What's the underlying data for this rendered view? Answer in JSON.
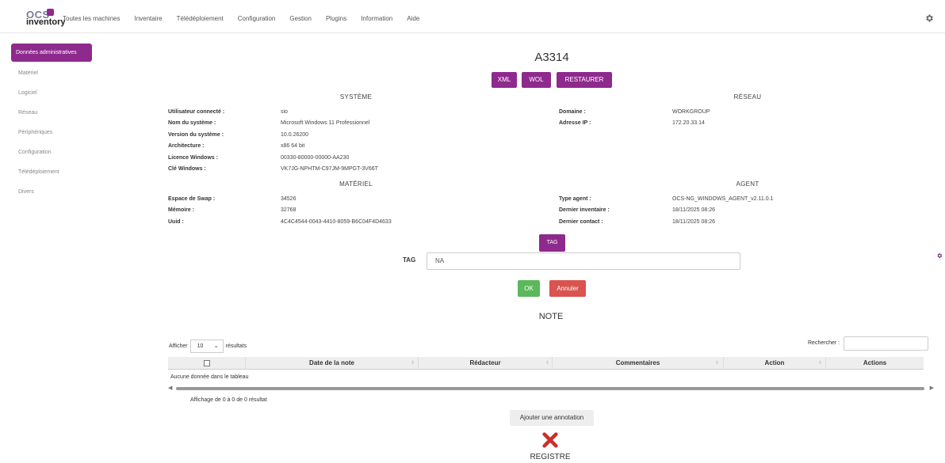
{
  "brand": {
    "logo_top": "OCS",
    "logo_bottom": "inventory"
  },
  "nav": [
    "Toutes les machines",
    "Inventaire",
    "Télédéploiement",
    "Configuration",
    "Gestion",
    "Plugins",
    "Information",
    "Aide"
  ],
  "sidebar": {
    "active": "Données administratives",
    "items": [
      "Matériel",
      "Logiciel",
      "Réseau",
      "Périphériques",
      "Configuration",
      "Télédéploiement",
      "Divers"
    ]
  },
  "machine_title": "A3314",
  "actions": {
    "xml": "XML",
    "wol": "WOL",
    "restaurer": "RESTAURER"
  },
  "systeme": {
    "title": "SYSTÈME",
    "rows": [
      {
        "label": "Utilisateur connecté :",
        "value": "sio"
      },
      {
        "label": "Nom du système :",
        "value": "Microsoft Windows 11 Professionnel"
      },
      {
        "label": "Version du système :",
        "value": "10.0.26200"
      },
      {
        "label": "Architecture :",
        "value": "x86 64 bit"
      },
      {
        "label": "Licence Windows :",
        "value": "00330-80000-00000-AA230"
      },
      {
        "label": "Clé Windows :",
        "value": "VK7JG-NPHTM-C97JM-9MPGT-3V66T"
      }
    ]
  },
  "reseau": {
    "title": "RÉSEAU",
    "rows": [
      {
        "label": "Domaine :",
        "value": "WORKGROUP"
      },
      {
        "label": "Adresse IP :",
        "value": "172.20.33.14"
      }
    ]
  },
  "materiel": {
    "title": "MATÉRIEL",
    "rows": [
      {
        "label": "Espace de Swap :",
        "value": "34526"
      },
      {
        "label": "Mémoire :",
        "value": "32768"
      },
      {
        "label": "Uuid :",
        "value": "4C4C4544-0043-4410-8059-B6C04F4D4633"
      }
    ]
  },
  "agent": {
    "title": "AGENT",
    "rows": [
      {
        "label": "Type agent :",
        "value": "OCS-NG_WINDOWS_AGENT_v2.11.0.1"
      },
      {
        "label": "Dernier inventaire :",
        "value": "18/11/2025 08:26"
      },
      {
        "label": "Dernier contact :",
        "value": "18/11/2025 08:26"
      }
    ]
  },
  "tag": {
    "button": "TAG",
    "label": "TAG",
    "value": "NA",
    "ok": "OK",
    "cancel": "Annuler"
  },
  "note": {
    "title": "NOTE",
    "show_prefix": "Afficher",
    "page_size": "10",
    "show_suffix": "résultats",
    "search_label": "Rechercher :",
    "columns": [
      "Date de la note",
      "Rédacteur",
      "Commentaires",
      "Action",
      "Actions"
    ],
    "empty": "Aucune donnée dans le tableau",
    "info": "Affichage de 0 à 0 de 0 résultat",
    "add_button": "Ajouter une annotation"
  },
  "registre": {
    "title": "REGISTRE"
  },
  "colors": {
    "accent": "#8e2a8d",
    "ok": "#5cb85c",
    "cancel": "#d9534f",
    "delete": "#c9302c"
  }
}
